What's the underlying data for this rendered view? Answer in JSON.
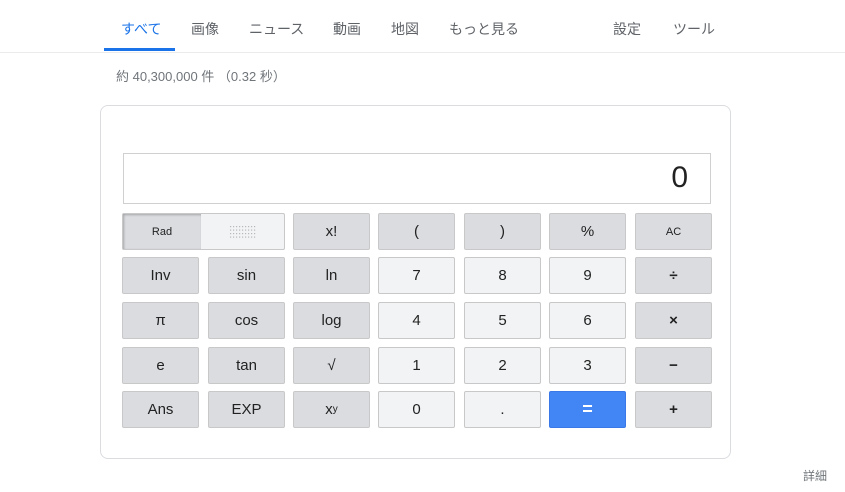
{
  "nav": {
    "tabs": [
      {
        "label": "すべて",
        "active": true
      },
      {
        "label": "画像"
      },
      {
        "label": "ニュース"
      },
      {
        "label": "動画"
      },
      {
        "label": "地図"
      },
      {
        "label": "もっと見る"
      }
    ],
    "settings_label": "設定",
    "tools_label": "ツール"
  },
  "result_stats": "約 40,300,000 件 （0.32 秒）",
  "calculator": {
    "display_value": "0",
    "mode_label": "Rad",
    "keys": {
      "factorial": "x!",
      "open_paren": "(",
      "close_paren": ")",
      "percent": "%",
      "all_clear": "AC",
      "inv": "Inv",
      "sin": "sin",
      "ln": "ln",
      "seven": "7",
      "eight": "8",
      "nine": "9",
      "divide": "÷",
      "pi": "π",
      "cos": "cos",
      "log": "log",
      "four": "4",
      "five": "5",
      "six": "6",
      "multiply": "×",
      "e": "e",
      "tan": "tan",
      "sqrt": "√",
      "one": "1",
      "two": "2",
      "three": "3",
      "minus": "−",
      "ans": "Ans",
      "exp": "EXP",
      "power_base": "x",
      "power_exp": "y",
      "zero": "0",
      "decimal": ".",
      "equals": "=",
      "plus": "+"
    }
  },
  "details_link": "詳細",
  "colors": {
    "accent": "#1a73e8",
    "equals": "#4285f4"
  }
}
